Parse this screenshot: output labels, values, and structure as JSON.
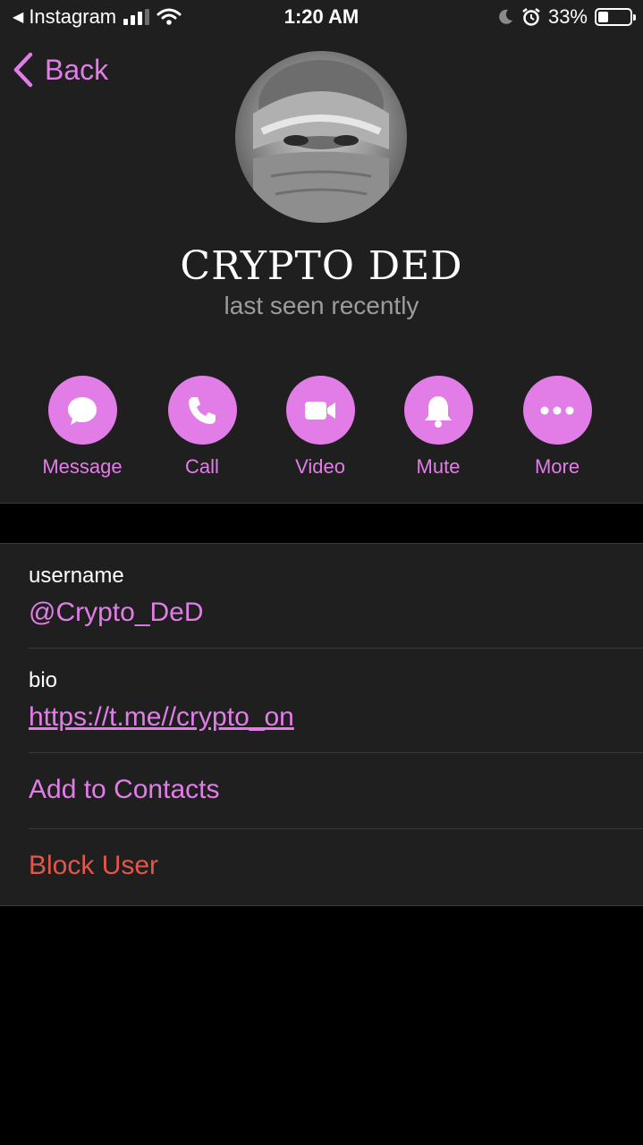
{
  "status_bar": {
    "back_app": "Instagram",
    "time": "1:20 AM",
    "battery_text": "33%",
    "battery_level": 0.33
  },
  "nav": {
    "back_label": "Back"
  },
  "profile": {
    "name": "CRYPTO DED",
    "status": "last seen recently"
  },
  "actions": [
    {
      "label": "Message",
      "icon": "message-bubble-icon"
    },
    {
      "label": "Call",
      "icon": "phone-icon"
    },
    {
      "label": "Video",
      "icon": "video-camera-icon"
    },
    {
      "label": "Mute",
      "icon": "bell-icon"
    },
    {
      "label": "More",
      "icon": "ellipsis-icon"
    }
  ],
  "info": {
    "username_title": "username",
    "username_value": "@Crypto_DeD",
    "bio_title": "bio",
    "bio_value": "https://t.me//crypto_on",
    "add_contacts": "Add to Contacts",
    "block_user": "Block User"
  },
  "colors": {
    "accent": "#e27de8",
    "danger": "#e3574a",
    "panel": "#1f1f1f",
    "background": "#000000"
  }
}
